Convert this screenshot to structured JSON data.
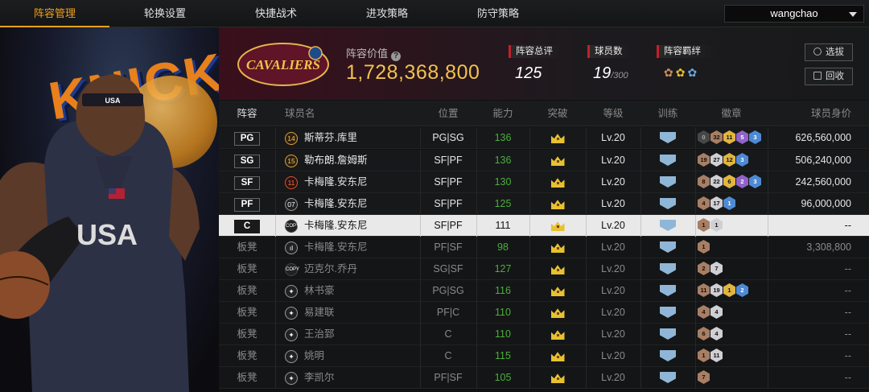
{
  "nav": {
    "tabs": [
      {
        "label": "阵容管理",
        "active": true
      },
      {
        "label": "轮换设置",
        "active": false
      },
      {
        "label": "快捷战术",
        "active": false
      },
      {
        "label": "进攻策略",
        "active": false
      },
      {
        "label": "防守策略",
        "active": false
      }
    ],
    "user": "wangchao"
  },
  "hero": {
    "sign_text": "KNICK"
  },
  "summary": {
    "team_logo_text": "CAVALIERS",
    "value_label": "阵容价值",
    "value": "1,728,368,800",
    "rating_label": "阵容总评",
    "rating": "125",
    "count_label": "球员数",
    "count": "19",
    "count_max": "/300",
    "bond_label": "阵容羁绊",
    "select_label": "选拔",
    "recycle_label": "回收"
  },
  "columns": {
    "lineup": "阵容",
    "name": "球员名",
    "position": "位置",
    "ability": "能力",
    "breakthrough": "突破",
    "level": "等级",
    "training": "训练",
    "badge": "徽章",
    "value": "球员身价"
  },
  "rows": [
    {
      "slot": "PG",
      "kind": "starter",
      "num": "14",
      "num_style": "gold",
      "name": "斯蒂芬.库里",
      "pos": "PG|SG",
      "ability": "136",
      "level": "Lv.20",
      "badges": [
        {
          "v": "0",
          "c": "c0"
        },
        {
          "v": "32",
          "c": "c1"
        },
        {
          "v": "11",
          "c": "c3"
        },
        {
          "v": "5",
          "c": "c4"
        },
        {
          "v": "3",
          "c": "c5"
        }
      ],
      "value": "626,560,000"
    },
    {
      "slot": "SG",
      "kind": "starter",
      "num": "15",
      "num_style": "gold",
      "name": "勒布朗.詹姆斯",
      "pos": "SF|PF",
      "ability": "136",
      "level": "Lv.20",
      "badges": [
        {
          "v": "19",
          "c": "c1"
        },
        {
          "v": "27",
          "c": "c2"
        },
        {
          "v": "12",
          "c": "c3"
        },
        {
          "v": "3",
          "c": "c5"
        }
      ],
      "value": "506,240,000"
    },
    {
      "slot": "SF",
      "kind": "starter",
      "num": "11",
      "num_style": "red",
      "name": "卡梅隆.安东尼",
      "pos": "SF|PF",
      "ability": "130",
      "level": "Lv.20",
      "badges": [
        {
          "v": "8",
          "c": "c1"
        },
        {
          "v": "22",
          "c": "c2"
        },
        {
          "v": "6",
          "c": "c3"
        },
        {
          "v": "2",
          "c": "c4"
        },
        {
          "v": "3",
          "c": "c5"
        }
      ],
      "value": "242,560,000"
    },
    {
      "slot": "PF",
      "kind": "starter",
      "num": "07",
      "num_style": "plain",
      "name": "卡梅隆.安东尼",
      "pos": "SF|PF",
      "ability": "125",
      "level": "Lv.20",
      "badges": [
        {
          "v": "4",
          "c": "c1"
        },
        {
          "v": "17",
          "c": "c2"
        },
        {
          "v": "1",
          "c": "c5"
        }
      ],
      "value": "96,000,000"
    },
    {
      "slot": "C",
      "kind": "sel",
      "num": "COPY",
      "num_style": "copy",
      "name": "卡梅隆.安东尼",
      "pos": "SF|PF",
      "ability": "111",
      "level": "Lv.20",
      "badges": [
        {
          "v": "1",
          "c": "c1"
        },
        {
          "v": "1",
          "c": "c2"
        }
      ],
      "value": "--"
    },
    {
      "slot": "板凳",
      "kind": "bench",
      "num": "ıl",
      "num_style": "plain",
      "name": "卡梅隆.安东尼",
      "pos": "PF|SF",
      "ability": "98",
      "level": "Lv.20",
      "badges": [
        {
          "v": "1",
          "c": "c1"
        }
      ],
      "value": "3,308,800"
    },
    {
      "slot": "板凳",
      "kind": "bench",
      "num": "COPY",
      "num_style": "copy",
      "name": "迈克尔.乔丹",
      "pos": "SG|SF",
      "ability": "127",
      "level": "Lv.20",
      "badges": [
        {
          "v": "2",
          "c": "c1"
        },
        {
          "v": "7",
          "c": "c2"
        }
      ],
      "value": "--"
    },
    {
      "slot": "板凳",
      "kind": "bench",
      "num": "✦",
      "num_style": "plain",
      "name": "林书豪",
      "pos": "PG|SG",
      "ability": "116",
      "level": "Lv.20",
      "badges": [
        {
          "v": "11",
          "c": "c1"
        },
        {
          "v": "19",
          "c": "c2"
        },
        {
          "v": "1",
          "c": "c3"
        },
        {
          "v": "2",
          "c": "c5"
        }
      ],
      "value": "--"
    },
    {
      "slot": "板凳",
      "kind": "bench",
      "num": "✦",
      "num_style": "plain",
      "name": "易建联",
      "pos": "PF|C",
      "ability": "110",
      "level": "Lv.20",
      "badges": [
        {
          "v": "4",
          "c": "c1"
        },
        {
          "v": "4",
          "c": "c2"
        }
      ],
      "value": "--"
    },
    {
      "slot": "板凳",
      "kind": "bench",
      "num": "✦",
      "num_style": "plain",
      "name": "王治郅",
      "pos": "C",
      "ability": "110",
      "level": "Lv.20",
      "badges": [
        {
          "v": "6",
          "c": "c1"
        },
        {
          "v": "4",
          "c": "c2"
        }
      ],
      "value": "--"
    },
    {
      "slot": "板凳",
      "kind": "bench",
      "num": "✦",
      "num_style": "plain",
      "name": "姚明",
      "pos": "C",
      "ability": "115",
      "level": "Lv.20",
      "badges": [
        {
          "v": "1",
          "c": "c1"
        },
        {
          "v": "11",
          "c": "c2"
        }
      ],
      "value": "--"
    },
    {
      "slot": "板凳",
      "kind": "bench",
      "num": "✦",
      "num_style": "plain",
      "name": "李凯尔",
      "pos": "PF|SF",
      "ability": "105",
      "level": "Lv.20",
      "badges": [
        {
          "v": "7",
          "c": "c1"
        }
      ],
      "value": "--"
    }
  ]
}
